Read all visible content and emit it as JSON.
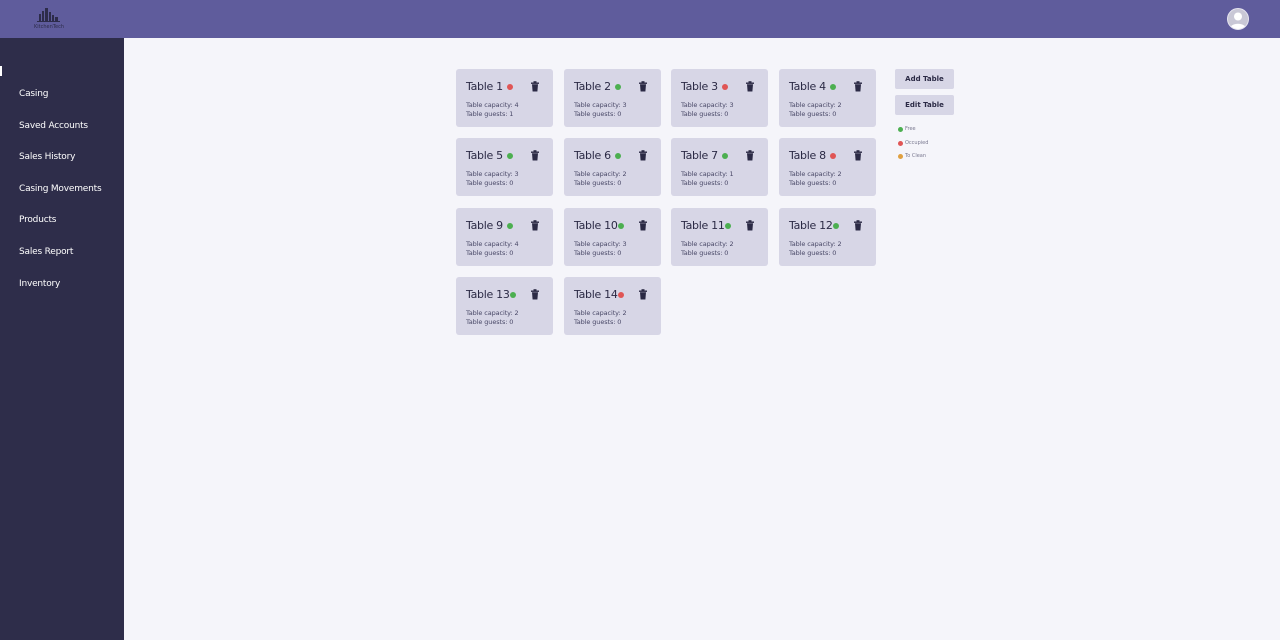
{
  "brand": {
    "name": "KitchenTech"
  },
  "colors": {
    "free": "#4caf50",
    "occupied": "#e05555",
    "to_clean": "#e0a040"
  },
  "sidebar": {
    "items": [
      {
        "label": "Casing"
      },
      {
        "label": "Saved Accounts"
      },
      {
        "label": "Sales History"
      },
      {
        "label": "Casing Movements"
      },
      {
        "label": "Products"
      },
      {
        "label": "Sales Report"
      },
      {
        "label": "Inventory"
      }
    ]
  },
  "toolbar": {
    "add_label": "Add Table",
    "edit_label": "Edit Table"
  },
  "legend": [
    {
      "label": "Free",
      "status": "free"
    },
    {
      "label": "Occupied",
      "status": "occupied"
    },
    {
      "label": "To Clean",
      "status": "to_clean"
    }
  ],
  "tables": [
    {
      "name": "Table 1",
      "status": "occupied",
      "capacity": "Table capacity: 4",
      "guests": "Table guests: 1"
    },
    {
      "name": "Table 2",
      "status": "free",
      "capacity": "Table capacity: 3",
      "guests": "Table guests: 0"
    },
    {
      "name": "Table 3",
      "status": "occupied",
      "capacity": "Table capacity: 3",
      "guests": "Table guests: 0"
    },
    {
      "name": "Table 4",
      "status": "free",
      "capacity": "Table capacity: 2",
      "guests": "Table guests: 0"
    },
    {
      "name": "Table 5",
      "status": "free",
      "capacity": "Table capacity: 3",
      "guests": "Table guests: 0"
    },
    {
      "name": "Table 6",
      "status": "free",
      "capacity": "Table capacity: 2",
      "guests": "Table guests: 0"
    },
    {
      "name": "Table 7",
      "status": "free",
      "capacity": "Table capacity: 1",
      "guests": "Table guests: 0"
    },
    {
      "name": "Table 8",
      "status": "occupied",
      "capacity": "Table capacity: 2",
      "guests": "Table guests: 0"
    },
    {
      "name": "Table 9",
      "status": "free",
      "capacity": "Table capacity: 4",
      "guests": "Table guests: 0"
    },
    {
      "name": "Table 10",
      "status": "free",
      "capacity": "Table capacity: 3",
      "guests": "Table guests: 0"
    },
    {
      "name": "Table 11",
      "status": "free",
      "capacity": "Table capacity: 2",
      "guests": "Table guests: 0"
    },
    {
      "name": "Table 12",
      "status": "free",
      "capacity": "Table capacity: 2",
      "guests": "Table guests: 0"
    },
    {
      "name": "Table 13",
      "status": "free",
      "capacity": "Table capacity: 2",
      "guests": "Table guests: 0"
    },
    {
      "name": "Table 14",
      "status": "occupied",
      "capacity": "Table capacity: 2",
      "guests": "Table guests: 0"
    }
  ]
}
